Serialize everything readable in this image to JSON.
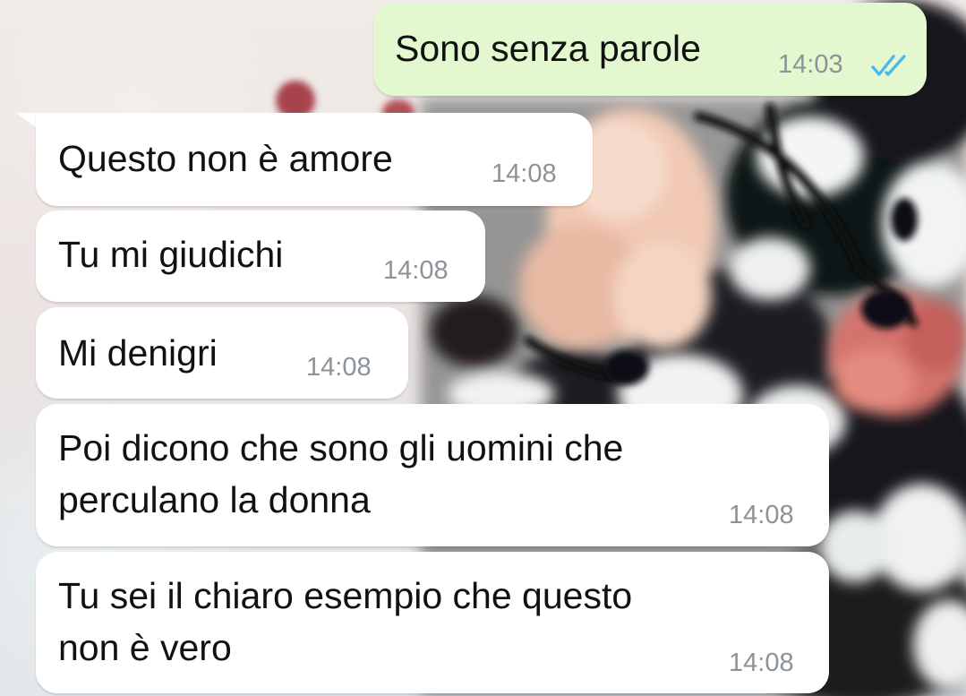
{
  "conversation": {
    "sent": [
      {
        "text": "Sono senza parole",
        "time": "14:03",
        "status_icon": "double-check-read-icon"
      }
    ],
    "received": [
      {
        "text": "Questo non è amore",
        "time": "14:08"
      },
      {
        "text": "Tu mi giudichi",
        "time": "14:08"
      },
      {
        "text": "Mi denigri",
        "time": "14:08"
      },
      {
        "text_line1": "Poi dicono che sono gli uomini che",
        "text_line2": "perculano la donna",
        "time": "14:08"
      },
      {
        "text_line1": "Tu sei il chiaro esempio che questo",
        "text_line2": "non è vero",
        "time": "14:08"
      }
    ]
  },
  "colors": {
    "incoming_bubble": "#ffffff",
    "outgoing_bubble": "#e3f8cf",
    "timestamp": "#8c9398",
    "read_ticks": "#4fb6ec"
  }
}
